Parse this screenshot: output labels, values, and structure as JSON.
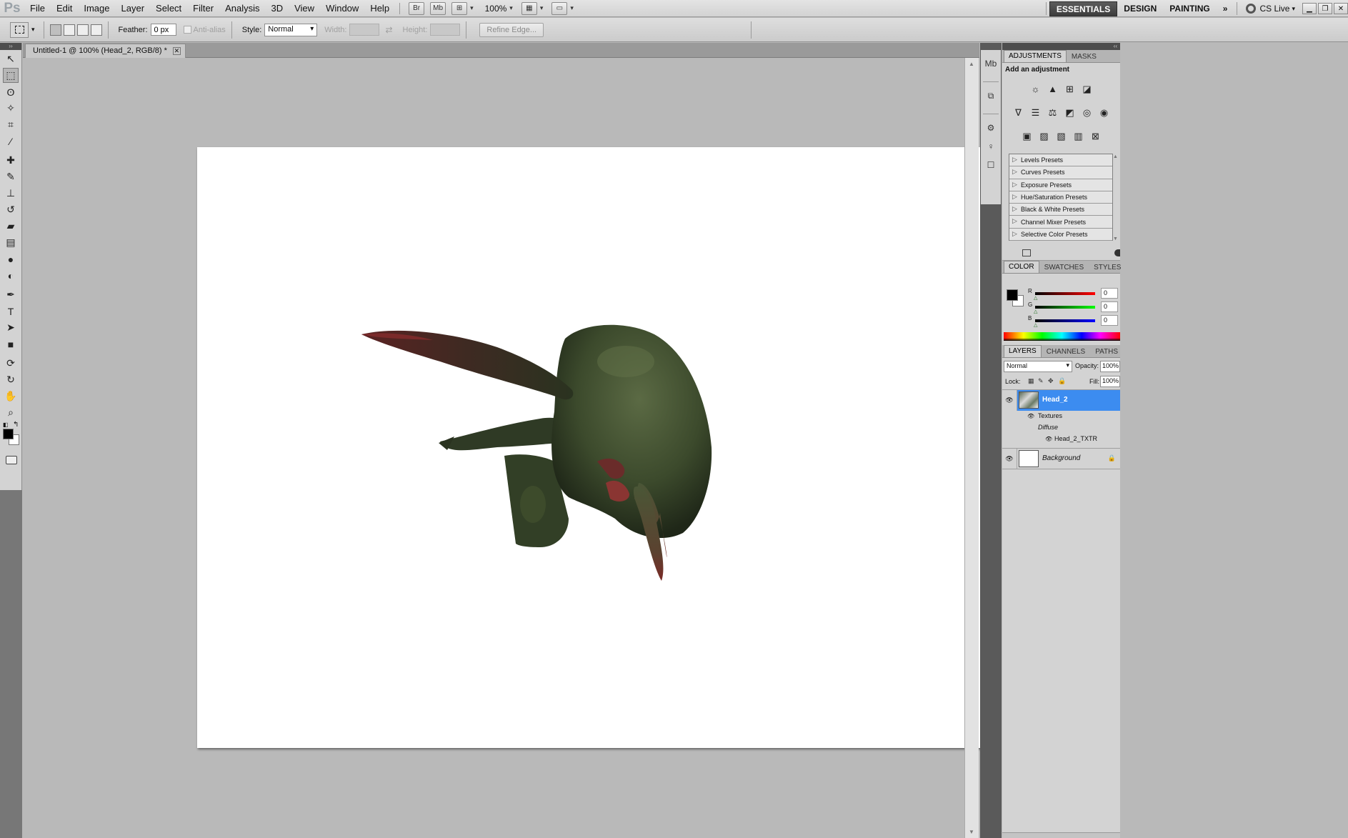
{
  "app": {
    "logo": "Ps"
  },
  "menu": [
    "File",
    "Edit",
    "Image",
    "Layer",
    "Select",
    "Filter",
    "Analysis",
    "3D",
    "View",
    "Window",
    "Help"
  ],
  "menubar_extras": {
    "bridge": "Br",
    "mini_bridge": "Mb",
    "zoom": "100%"
  },
  "workspaces": {
    "items": [
      "ESSENTIALS",
      "DESIGN",
      "PAINTING"
    ],
    "active": "ESSENTIALS",
    "more": "»",
    "cslive": "CS Live"
  },
  "options": {
    "feather_label": "Feather:",
    "feather_value": "0 px",
    "antialias_label": "Anti-alias",
    "style_label": "Style:",
    "style_value": "Normal",
    "width_label": "Width:",
    "height_label": "Height:",
    "refine_edge": "Refine Edge..."
  },
  "tools": [
    {
      "name": "move-tool",
      "glyph": "↖"
    },
    {
      "name": "rectangular-marquee-tool",
      "glyph": "⬚",
      "active": true
    },
    {
      "name": "lasso-tool",
      "glyph": "ʘ"
    },
    {
      "name": "quick-selection-tool",
      "glyph": "✧"
    },
    {
      "name": "crop-tool",
      "glyph": "⌗"
    },
    {
      "name": "eyedropper-tool",
      "glyph": "⁄"
    },
    {
      "name": "spot-healing-brush-tool",
      "glyph": "✚"
    },
    {
      "name": "brush-tool",
      "glyph": "✎"
    },
    {
      "name": "clone-stamp-tool",
      "glyph": "⊥"
    },
    {
      "name": "history-brush-tool",
      "glyph": "↺"
    },
    {
      "name": "eraser-tool",
      "glyph": "▰"
    },
    {
      "name": "gradient-tool",
      "glyph": "▤"
    },
    {
      "name": "blur-tool",
      "glyph": "●"
    },
    {
      "name": "dodge-tool",
      "glyph": "◐"
    },
    {
      "name": "pen-tool",
      "glyph": "✒"
    },
    {
      "name": "type-tool",
      "glyph": "T"
    },
    {
      "name": "path-selection-tool",
      "glyph": "➤"
    },
    {
      "name": "rectangle-tool",
      "glyph": "■"
    },
    {
      "name": "3d-rotate-tool",
      "glyph": "⟳"
    },
    {
      "name": "3d-orbit-tool",
      "glyph": "↻"
    },
    {
      "name": "hand-tool",
      "glyph": "✋"
    },
    {
      "name": "zoom-tool",
      "glyph": "⌕"
    }
  ],
  "document": {
    "tab_title": "Untitled-1 @ 100% (Head_2, RGB/8) *"
  },
  "adjustments": {
    "tabs": [
      "ADJUSTMENTS",
      "MASKS"
    ],
    "title": "Add an adjustment",
    "icon_rows": [
      [
        "☼",
        "▲",
        "⊞",
        "◪"
      ],
      [
        "∇",
        "☰",
        "⚖",
        "◩",
        "◎",
        "◉"
      ],
      [
        "▣",
        "▨",
        "▧",
        "▥",
        "⊠"
      ]
    ],
    "presets": [
      "Levels Presets",
      "Curves Presets",
      "Exposure Presets",
      "Hue/Saturation Presets",
      "Black & White Presets",
      "Channel Mixer Presets",
      "Selective Color Presets"
    ]
  },
  "color": {
    "tabs": [
      "COLOR",
      "SWATCHES",
      "STYLES"
    ],
    "channels": [
      {
        "label": "R",
        "value": "0",
        "gradient": "linear-gradient(90deg,#000,#f00)"
      },
      {
        "label": "G",
        "value": "0",
        "gradient": "linear-gradient(90deg,#000,#0f0)"
      },
      {
        "label": "B",
        "value": "0",
        "gradient": "linear-gradient(90deg,#000,#00f)"
      }
    ]
  },
  "layers": {
    "tabs": [
      "LAYERS",
      "CHANNELS",
      "PATHS"
    ],
    "blend_mode": "Normal",
    "opacity_label": "Opacity:",
    "opacity": "100%",
    "lock_label": "Lock:",
    "fill_label": "Fill:",
    "fill": "100%",
    "items": [
      {
        "name": "Head_2",
        "selected": true
      },
      {
        "name": "Background",
        "locked": true
      }
    ],
    "sublayers": {
      "textures": "Textures",
      "diffuse": "Diffuse",
      "texture_name": "Head_2_TXTR"
    }
  }
}
